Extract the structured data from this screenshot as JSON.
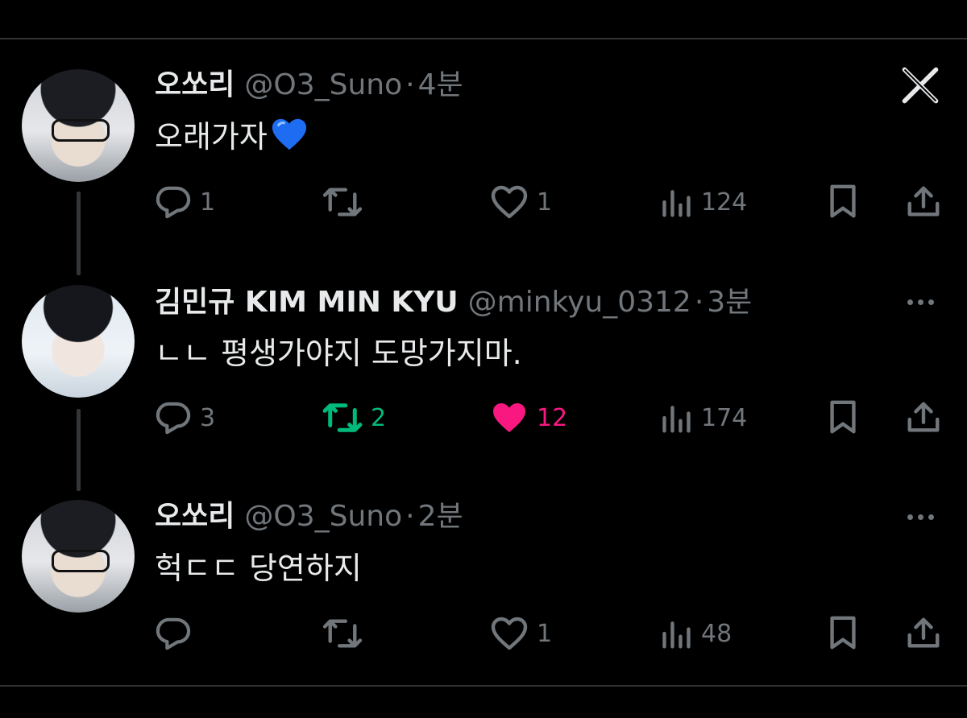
{
  "tweets": [
    {
      "avatar": "suno-avatar",
      "name": "오쏘리",
      "handle": "@O3_Suno",
      "time": "4분",
      "text": "오래가자",
      "emoji": "blue-heart-icon",
      "reply_count": "1",
      "retweet_count": "",
      "like_count": "1",
      "view_count": "124"
    },
    {
      "avatar": "minkyu-avatar",
      "name": "김민규 KIM MIN KYU",
      "handle": "@minkyu_0312",
      "time": "3분",
      "text": "ㄴㄴ 평생가야지 도망가지마.",
      "reply_count": "3",
      "retweet_count": "2",
      "like_count": "12",
      "view_count": "174",
      "retweeted": true,
      "liked": true
    },
    {
      "avatar": "suno-avatar",
      "name": "오쏘리",
      "handle": "@O3_Suno",
      "time": "2분",
      "text": "헉ㄷㄷ 당연하지",
      "reply_count": "",
      "retweet_count": "",
      "like_count": "1",
      "view_count": "48"
    }
  ],
  "colors": {
    "background": "#000000",
    "text": "#e7e9ea",
    "muted": "#71767b",
    "retweet_active": "#00ba7c",
    "like_active": "#f91880",
    "divider": "#2f3336"
  },
  "sep": "·"
}
